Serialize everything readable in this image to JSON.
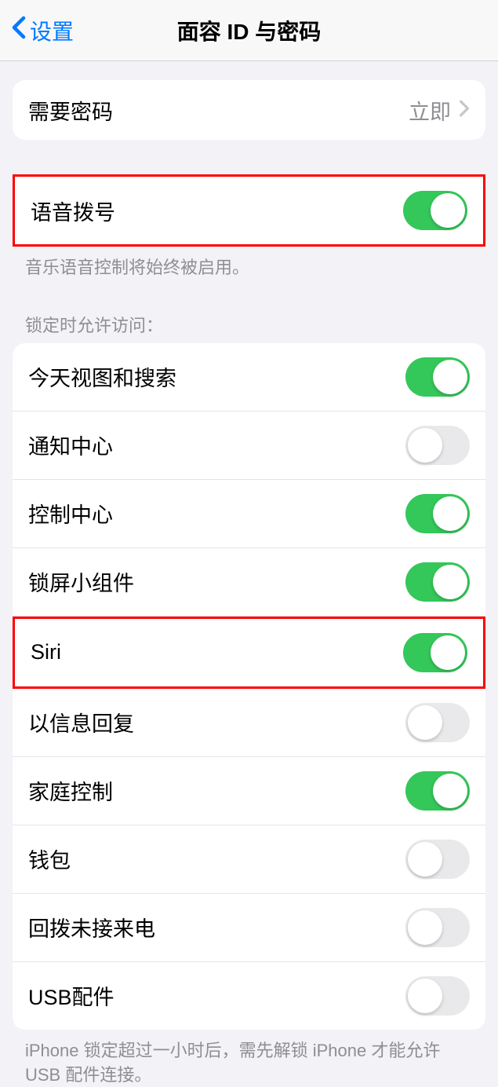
{
  "nav": {
    "back_label": "设置",
    "title": "面容 ID 与密码"
  },
  "require_passcode": {
    "label": "需要密码",
    "value": "立即"
  },
  "voice_dial": {
    "label": "语音拨号",
    "footer": "音乐语音控制将始终被启用。"
  },
  "allow_access_header": "锁定时允许访问：",
  "access_items": {
    "today": "今天视图和搜索",
    "notification": "通知中心",
    "control": "控制中心",
    "widgets": "锁屏小组件",
    "siri": "Siri",
    "reply": "以信息回复",
    "home": "家庭控制",
    "wallet": "钱包",
    "callback": "回拨未接来电",
    "usb": "USB配件"
  },
  "usb_footer": "iPhone 锁定超过一小时后，需先解锁 iPhone 才能允许USB 配件连接。"
}
